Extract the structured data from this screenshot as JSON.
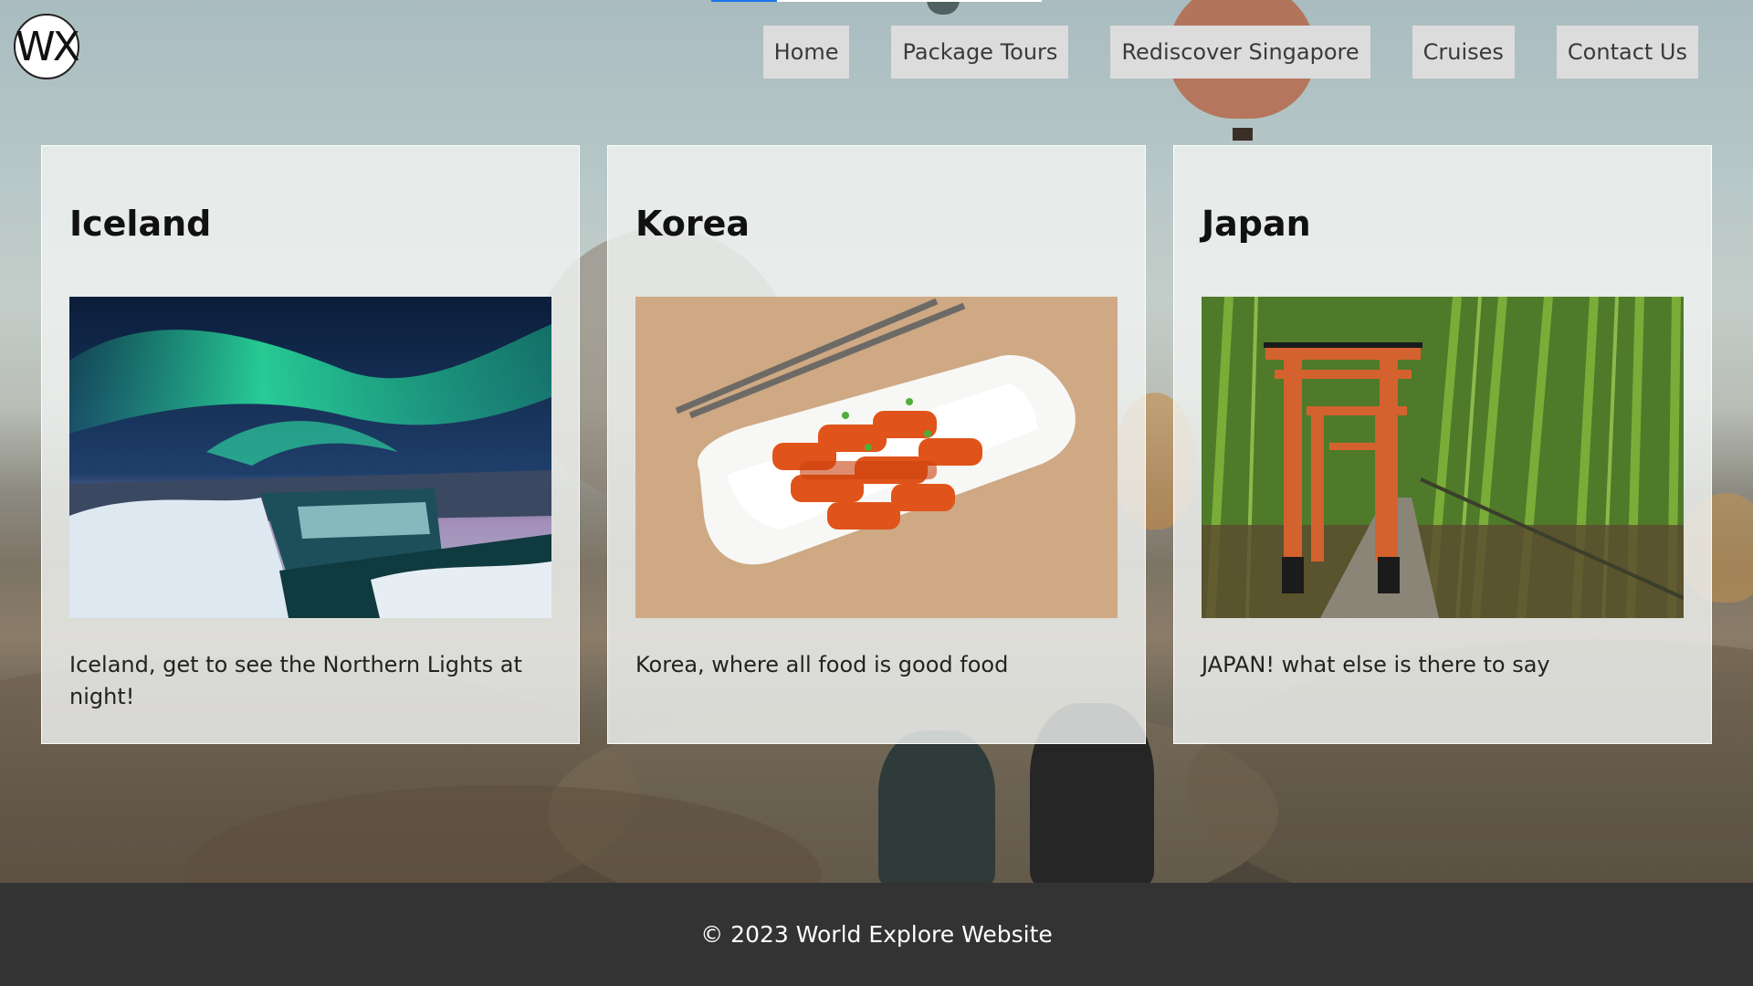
{
  "brand": {
    "logo_text": "WX"
  },
  "nav": {
    "items": [
      {
        "label": "Home"
      },
      {
        "label": "Package Tours"
      },
      {
        "label": "Rediscover Singapore"
      },
      {
        "label": "Cruises"
      },
      {
        "label": "Contact Us"
      }
    ]
  },
  "loading": {
    "progress": 0.2
  },
  "cards": [
    {
      "title": "Iceland",
      "description": "Iceland, get to see the Northern Lights at night!"
    },
    {
      "title": "Korea",
      "description": "Korea, where all food is good food"
    },
    {
      "title": "Japan",
      "description": "JAPAN! what else is there to say"
    }
  ],
  "footer": {
    "text": "© 2023 World Explore Website"
  },
  "colors": {
    "footer_bg": "#333333",
    "nav_bg": "#dcdcdc",
    "loading_accent": "#1a73e8"
  }
}
